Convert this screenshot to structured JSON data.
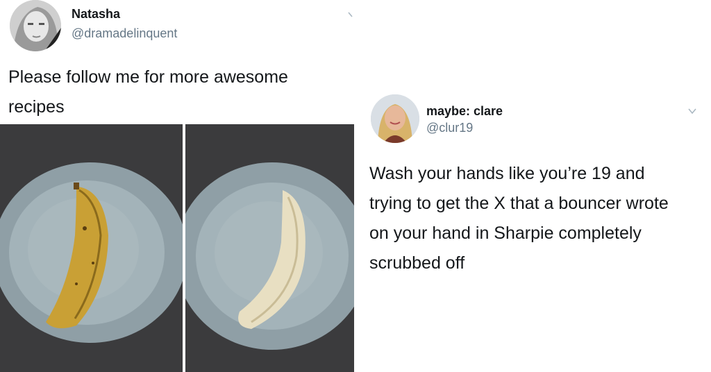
{
  "tweet1": {
    "name": "Natasha",
    "handle": "@dramadelinquent",
    "text_line1": "Please follow me for more awesome",
    "text_line2": "recipes",
    "icons": {
      "menu": "chevron-down-icon"
    }
  },
  "tweet2": {
    "name": "maybe: clare",
    "handle": "@clur19",
    "text_lines": [
      "Wash your hands like you’re 19 and",
      "trying to get the X that a bouncer wrote",
      "on your hand in Sharpie completely",
      "scrubbed off"
    ],
    "icons": {
      "menu": "chevron-down-icon"
    }
  },
  "colors": {
    "text": "#14171a",
    "handle": "#657786",
    "chevron": "#aab8c2"
  }
}
